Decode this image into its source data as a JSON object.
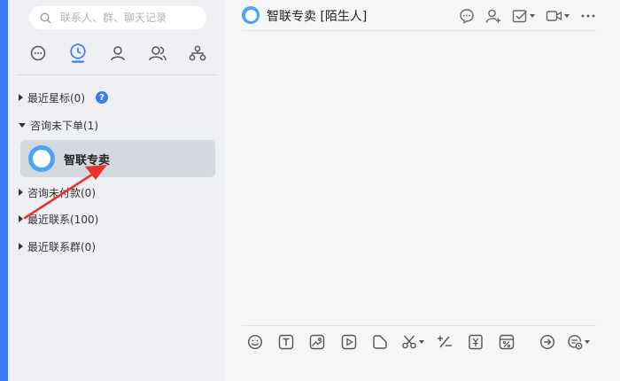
{
  "colors": {
    "accent": "#3b7cf5",
    "avatar": "#4aa3f5",
    "selected": "#d4d8df"
  },
  "search": {
    "placeholder": "联系人、群、聊天记录"
  },
  "nav": [
    "chat-icon",
    "recent-clock-icon",
    "contact-icon",
    "group-icon",
    "org-icon"
  ],
  "groups": [
    {
      "label": "最近星标(0)",
      "expanded": false
    },
    {
      "label": "咨询未下单(1)",
      "expanded": true
    },
    {
      "label": "咨询未付款(0)",
      "expanded": false
    },
    {
      "label": "最近联系(100)",
      "expanded": false
    },
    {
      "label": "最近联系群(0)",
      "expanded": false
    }
  ],
  "help_badge": "?",
  "contact": {
    "name": "智联专卖"
  },
  "chat": {
    "title": "智联专卖 [陌生人]"
  }
}
